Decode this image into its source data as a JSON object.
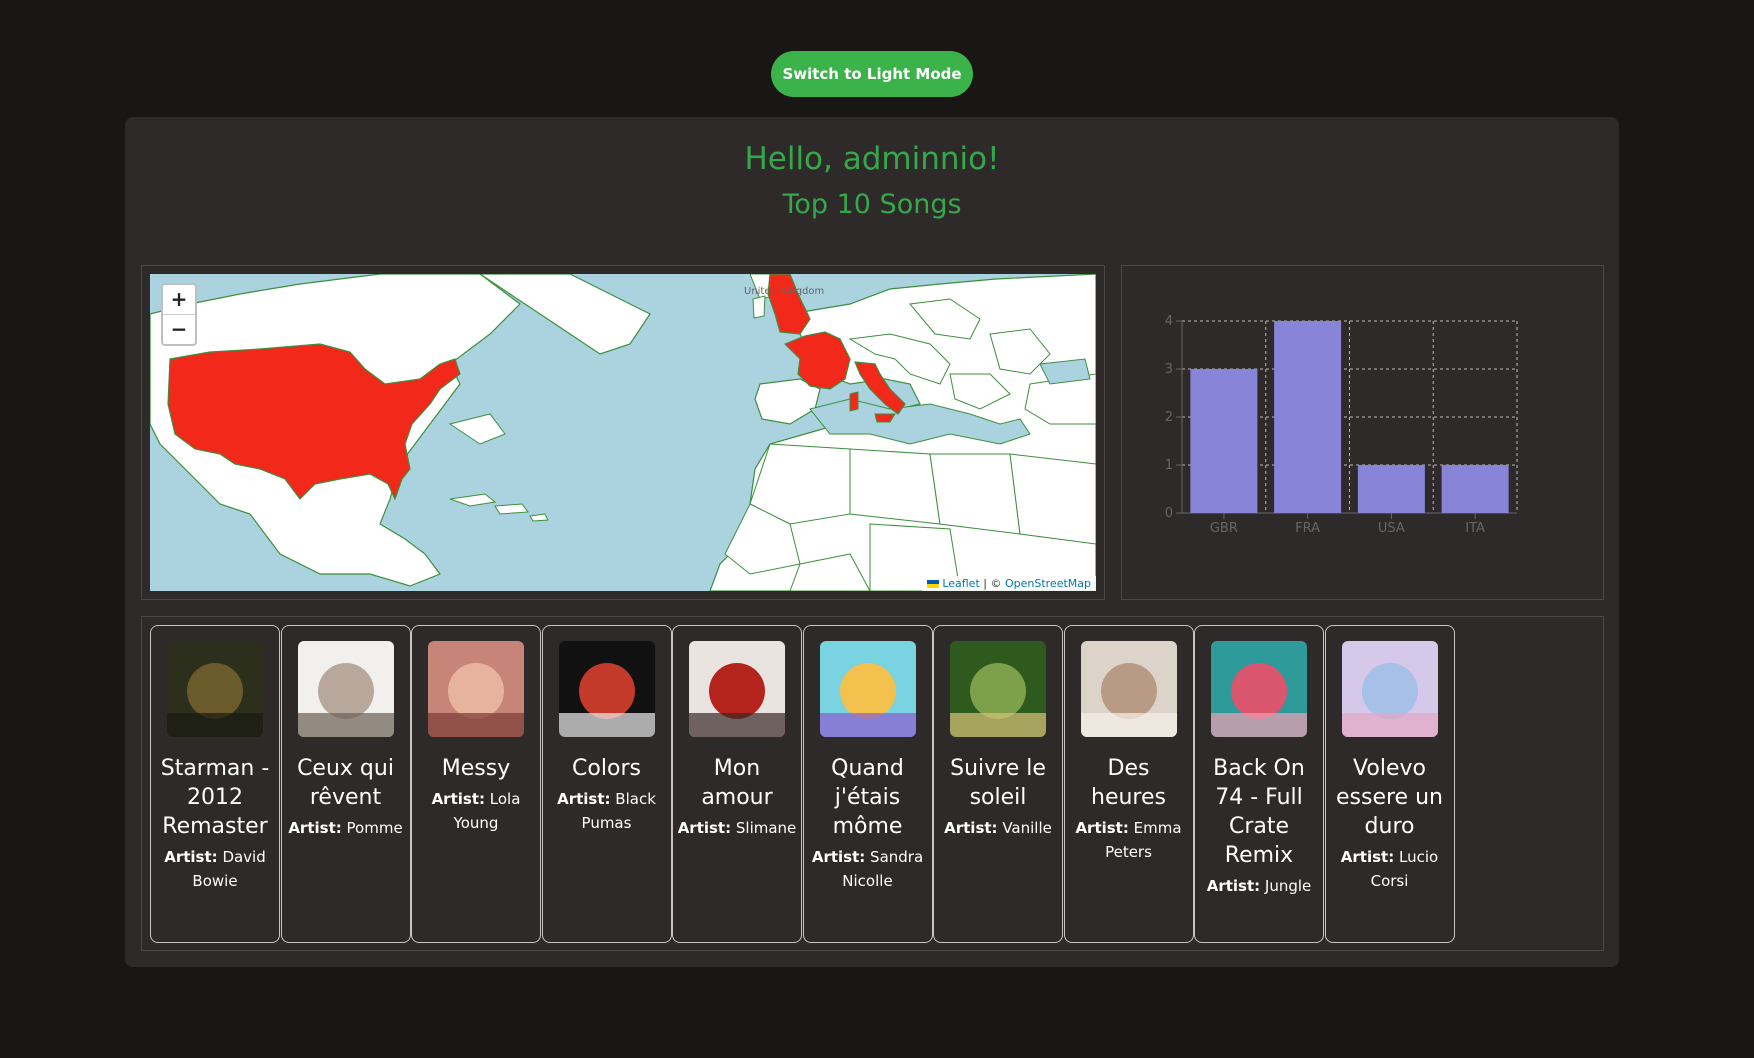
{
  "theme_button": {
    "label": "Switch to Light Mode"
  },
  "header": {
    "greeting": "Hello, adminnio!",
    "subtitle": "Top 10 Songs"
  },
  "map": {
    "zoom_in": "+",
    "zoom_out": "−",
    "label_uk": "United Kingdom",
    "attribution_leaflet": "Leaflet",
    "attribution_sep": " | © ",
    "attribution_osm": "OpenStreetMap",
    "highlighted_countries": [
      "USA",
      "GBR",
      "FRA",
      "ITA"
    ],
    "colors": {
      "water": "#aad3df",
      "land": "#ffffff",
      "border": "#3d8f3d",
      "highlight": "#f2281b"
    }
  },
  "chart_data": {
    "type": "bar",
    "categories": [
      "GBR",
      "FRA",
      "USA",
      "ITA"
    ],
    "values": [
      3,
      4,
      1,
      1
    ],
    "yticks": [
      0,
      1,
      2,
      3,
      4
    ],
    "ylim": [
      0,
      4
    ],
    "grid": true,
    "bar_color": "#8884d8"
  },
  "artist_label": "Artist:",
  "songs": [
    {
      "title": "Starman - 2012 Remaster",
      "artist": "David Bowie",
      "cover_icon": "album-cover-starman"
    },
    {
      "title": "Ceux qui rêvent",
      "artist": "Pomme",
      "cover_icon": "album-cover-pomme"
    },
    {
      "title": "Messy",
      "artist": "Lola Young",
      "cover_icon": "album-cover-messy"
    },
    {
      "title": "Colors",
      "artist": "Black Pumas",
      "cover_icon": "album-cover-black-pumas"
    },
    {
      "title": "Mon amour",
      "artist": "Slimane",
      "cover_icon": "album-cover-slimane"
    },
    {
      "title": "Quand j'étais môme",
      "artist": "Sandra Nicolle",
      "cover_icon": "album-cover-sandra-nicolle"
    },
    {
      "title": "Suivre le soleil",
      "artist": "Vanille",
      "cover_icon": "album-cover-vanille"
    },
    {
      "title": "Des heures",
      "artist": "Emma Peters",
      "cover_icon": "album-cover-emma-peters"
    },
    {
      "title": "Back On 74 - Full Crate Remix",
      "artist": "Jungle",
      "cover_icon": "album-cover-jungle"
    },
    {
      "title": "Volevo essere un duro",
      "artist": "Lucio Corsi",
      "cover_icon": "album-cover-lucio-corsi"
    }
  ]
}
